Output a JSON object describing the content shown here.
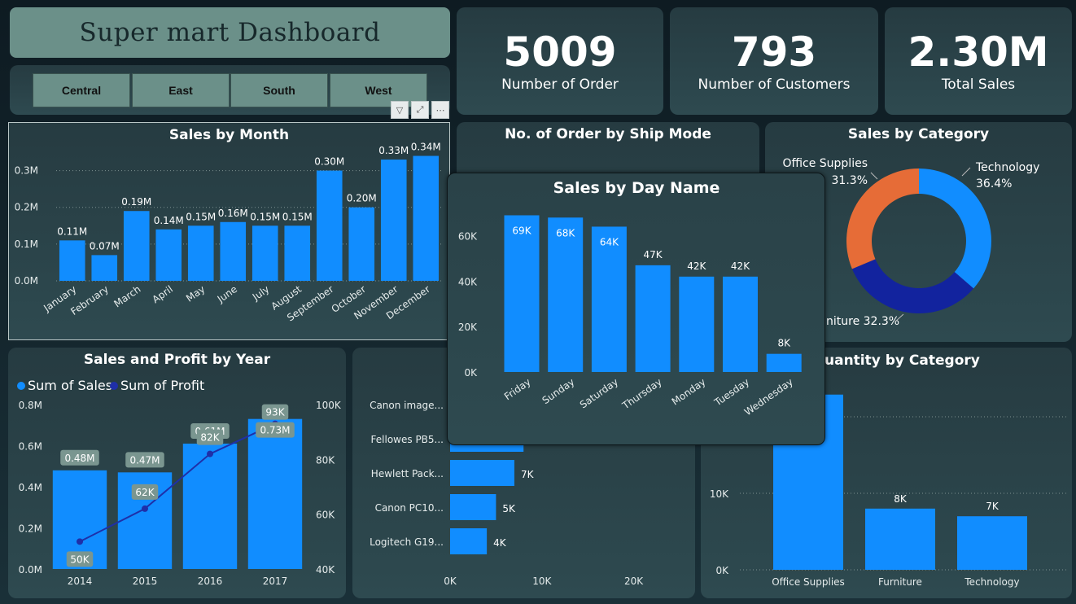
{
  "header": {
    "title": "Super mart Dashboard"
  },
  "slicer": {
    "items": [
      "Central",
      "East",
      "South",
      "West"
    ]
  },
  "kpis": {
    "orders": {
      "value": "5009",
      "label": "Number of Order"
    },
    "customers": {
      "value": "793",
      "label": "Number of Customers"
    },
    "sales": {
      "value": "2.30M",
      "label": "Total Sales"
    }
  },
  "colors": {
    "bar": "#118dff",
    "profit": "#1f2fa8",
    "orange": "#e66c37",
    "navy": "#12239e"
  },
  "chart_data": [
    {
      "id": "sales_by_month",
      "type": "bar",
      "title": "Sales by Month",
      "categories": [
        "January",
        "February",
        "March",
        "April",
        "May",
        "June",
        "July",
        "August",
        "September",
        "October",
        "November",
        "December"
      ],
      "values": [
        0.11,
        0.07,
        0.19,
        0.14,
        0.15,
        0.16,
        0.15,
        0.15,
        0.3,
        0.2,
        0.33,
        0.34
      ],
      "data_labels": [
        "0.11M",
        "0.07M",
        "0.19M",
        "0.14M",
        "0.15M",
        "0.16M",
        "0.15M",
        "0.15M",
        "0.30M",
        "0.20M",
        "0.33M",
        "0.34M"
      ],
      "yticks": [
        "0.0M",
        "0.1M",
        "0.2M",
        "0.3M"
      ],
      "ylim": [
        0,
        0.35
      ],
      "grid": true
    },
    {
      "id": "sales_profit_by_year",
      "type": "bar",
      "title": "Sales and Profit by Year",
      "categories": [
        "2014",
        "2015",
        "2016",
        "2017"
      ],
      "series": [
        {
          "name": "Sum of Sales",
          "type": "bar",
          "values": [
            0.48,
            0.47,
            0.61,
            0.73
          ],
          "data_labels": [
            "0.48M",
            "0.47M",
            "0.61M",
            "0.73M"
          ]
        },
        {
          "name": "Sum of Profit",
          "type": "line",
          "values": [
            50,
            62,
            82,
            93
          ],
          "data_labels": [
            "50K",
            "62K",
            "82K",
            "93K"
          ]
        }
      ],
      "yticks_left": [
        "0.0M",
        "0.2M",
        "0.4M",
        "0.6M",
        "0.8M"
      ],
      "ylim_left": [
        0,
        0.8
      ],
      "yticks_right": [
        "40K",
        "60K",
        "80K",
        "100K"
      ],
      "ylim_right": [
        40,
        100
      ],
      "legend": "top-left"
    },
    {
      "id": "top_products",
      "type": "bar",
      "orientation": "horizontal",
      "categories": [
        "Canon image...",
        "Fellowes PB5...",
        "Hewlett Pack...",
        "Canon PC10...",
        "Logitech G19..."
      ],
      "values": [
        null,
        8,
        7,
        5,
        4
      ],
      "data_labels": [
        "",
        "",
        "7K",
        "5K",
        "4K"
      ],
      "xticks": [
        "0K",
        "10K",
        "20K"
      ],
      "xlim": [
        0,
        25
      ]
    },
    {
      "id": "sales_by_category",
      "type": "pie",
      "title": "Sales by Category",
      "categories": [
        "Technology",
        "Furniture",
        "Office Supplies"
      ],
      "values": [
        36.4,
        32.3,
        31.3
      ],
      "labels": [
        "Technology",
        "niture 32.3%",
        "Office Supplies"
      ],
      "percent_labels": [
        "36.4%",
        "",
        "31.3%"
      ]
    },
    {
      "id": "quantity_by_category",
      "type": "bar",
      "title_visible": "uantity by Category",
      "categories": [
        "Office Supplies",
        "Furniture",
        "Technology"
      ],
      "values": [
        22.9,
        8,
        7
      ],
      "data_labels": [
        "",
        "8K",
        "7K"
      ],
      "yticks": [
        "0K",
        "10K"
      ],
      "ylim": [
        0,
        20
      ]
    },
    {
      "id": "sales_by_day_name",
      "type": "bar",
      "title": "Sales by Day Name",
      "categories": [
        "Friday",
        "Sunday",
        "Saturday",
        "Thursday",
        "Monday",
        "Tuesday",
        "Wednesday"
      ],
      "values": [
        69,
        68,
        64,
        47,
        42,
        42,
        8
      ],
      "data_labels": [
        "69K",
        "68K",
        "64K",
        "47K",
        "42K",
        "42K",
        "8K"
      ],
      "yticks": [
        "0K",
        "20K",
        "40K",
        "60K"
      ],
      "ylim": [
        0,
        72
      ]
    }
  ],
  "ship_mode": {
    "title": "No. of Order by Ship Mode"
  }
}
